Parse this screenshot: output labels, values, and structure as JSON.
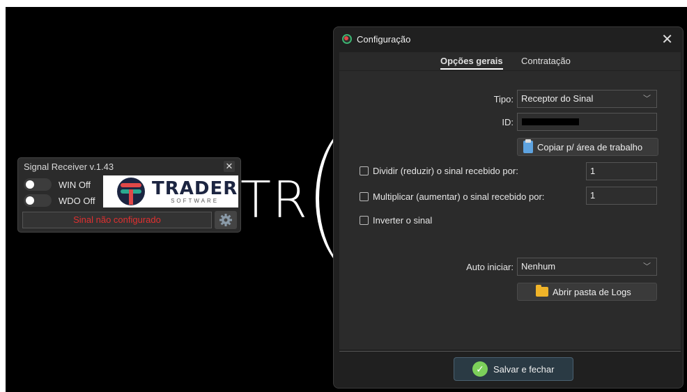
{
  "widget": {
    "title": "Signal Receiver v.1.43",
    "close_glyph": "✕",
    "toggles": [
      {
        "label": "WIN Off"
      },
      {
        "label": "WDO Off"
      }
    ],
    "logo_main": "TRADER",
    "logo_sub": "SOFTWARE",
    "status": "Sinal não configurado",
    "status_color": "#e03030"
  },
  "background": {
    "text": "TR"
  },
  "dialog": {
    "title": "Configuração",
    "close_glyph": "✕",
    "tabs": [
      {
        "label": "Opções gerais",
        "active": true
      },
      {
        "label": "Contratação",
        "active": false
      }
    ],
    "tipo_label": "Tipo:",
    "tipo_value": "Receptor do Sinal",
    "id_label": "ID:",
    "copy_button": "Copiar p/ área de trabalho",
    "divide_label": "Dividir (reduzir) o sinal recebido por:",
    "divide_value": "1",
    "multiply_label": "Multiplicar (aumentar) o sinal recebido por:",
    "multiply_value": "1",
    "invert_label": "Inverter o sinal",
    "auto_label": "Auto iniciar:",
    "auto_value": "Nenhum",
    "logs_button": "Abrir pasta de Logs",
    "save_button": "Salvar e fechar",
    "chevron_glyph": "﹀"
  }
}
